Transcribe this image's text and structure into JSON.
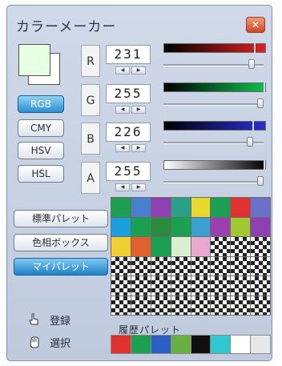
{
  "window": {
    "title": "カラーメーカー",
    "close_icon": "close-icon",
    "close_color": "#d2482a"
  },
  "preview": {
    "front_color": "#e7ffe2",
    "back_color": "#ffffff"
  },
  "modes": [
    {
      "label": "RGB",
      "active": true
    },
    {
      "label": "CMY",
      "active": false
    },
    {
      "label": "HSV",
      "active": false
    },
    {
      "label": "HSL",
      "active": false
    }
  ],
  "channels": [
    {
      "name": "R",
      "value": "231",
      "level": 0.906,
      "gradient_from": "#000000",
      "gradient_to": "#e02020"
    },
    {
      "name": "G",
      "value": "255",
      "level": 1.0,
      "gradient_from": "#000000",
      "gradient_to": "#10c050"
    },
    {
      "name": "B",
      "value": "226",
      "level": 0.886,
      "gradient_from": "#000000",
      "gradient_to": "#2830d0"
    },
    {
      "name": "A",
      "value": "255",
      "level": 1.0,
      "gradient_from": "#ffffff",
      "gradient_to": "#000000"
    }
  ],
  "palette_buttons": [
    {
      "label": "標準パレット",
      "active": false
    },
    {
      "label": "色相ボックス",
      "active": false
    },
    {
      "label": "マイパレット",
      "active": true
    }
  ],
  "palette_colors": [
    "#1aa050",
    "#4a7fcf",
    "#8e3fb0",
    "#2aa088",
    "#e8d830",
    "#1aa050",
    "#e03030",
    "#6a6fc8",
    "#1aa0e0",
    "#1aa050",
    "#2a8a40",
    "#1aa050",
    "#3aa0d0",
    "#9a3fb0",
    "#a0c830",
    "#8e3fb0",
    "#f0d030",
    "#e06030",
    "#1aa050",
    "#d8f0d0",
    "#e8a8d0",
    "empty",
    "empty",
    "empty",
    "empty",
    "empty",
    "empty",
    "empty",
    "empty",
    "empty",
    "empty",
    "empty",
    "empty",
    "empty",
    "empty",
    "empty",
    "empty",
    "empty",
    "empty",
    "empty",
    "empty",
    "empty",
    "empty",
    "empty",
    "empty",
    "empty",
    "empty",
    "empty"
  ],
  "actions": [
    {
      "label": "登録",
      "icon": "hand-point-icon"
    },
    {
      "label": "選択",
      "icon": "hand-grab-icon"
    }
  ],
  "history": {
    "label": "履歴パレット",
    "colors": [
      "#e03030",
      "#1aa050",
      "#2a5fc8",
      "#6ab040",
      "#101010",
      "#30c8d0",
      "#ffffff",
      "#e8e8e8"
    ]
  }
}
